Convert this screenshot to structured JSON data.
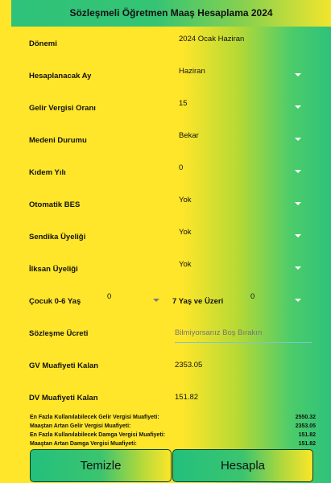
{
  "header": {
    "title": "Sözleşmeli Öğretmen Maaş Hesaplama 2024"
  },
  "fields": {
    "donemi": {
      "label": "Dönemi",
      "value": "2024 Ocak Haziran"
    },
    "hesaplanacak_ay": {
      "label": "Hesaplanacak Ay",
      "value": "Haziran"
    },
    "gelir_vergisi_orani": {
      "label": "Gelir Vergisi Oranı",
      "value": "15"
    },
    "medeni_durumu": {
      "label": "Medeni Durumu",
      "value": "Bekar"
    },
    "kidem_yili": {
      "label": "Kıdem Yılı",
      "value": "0"
    },
    "otomatik_bes": {
      "label": "Otomatik BES",
      "value": "Yok"
    },
    "sendika_uyeligi": {
      "label": "Sendika Üyeliği",
      "value": "Yok"
    },
    "ilksan_uyeligi": {
      "label": "İlksan Üyeliği",
      "value": "Yok"
    },
    "cocuk_0_6": {
      "label": "Çocuk 0-6 Yaş",
      "value": "0"
    },
    "cocuk_7_ustu": {
      "label": "7 Yaş ve Üzeri",
      "value": "0"
    },
    "sozlesme_ucreti": {
      "label": "Sözleşme Ücreti",
      "placeholder": "Bilmiyorsanız Boş Bırakın"
    },
    "gv_muafiyeti_kalan": {
      "label": "GV Muafiyeti Kalan",
      "value": "2353.05"
    },
    "dv_muafiyeti_kalan": {
      "label": "DV Muafiyeti Kalan",
      "value": "151.82"
    }
  },
  "summary": [
    {
      "label": "En Fazla Kullanılabilecek Gelir Vergisi Muafiyeti:",
      "value": "2550.32"
    },
    {
      "label": "Maaştan Artan Gelir Vergisi Muafiyeti:",
      "value": "2353.05"
    },
    {
      "label": "En Fazla Kullanılabilecek Damga Vergisi Muafiyeti:",
      "value": "151.82"
    },
    {
      "label": "Maaştan Artan Damga Vergisi Muafiyeti:",
      "value": "151.82"
    }
  ],
  "buttons": {
    "clear": "Temizle",
    "calculate": "Hesapla"
  }
}
